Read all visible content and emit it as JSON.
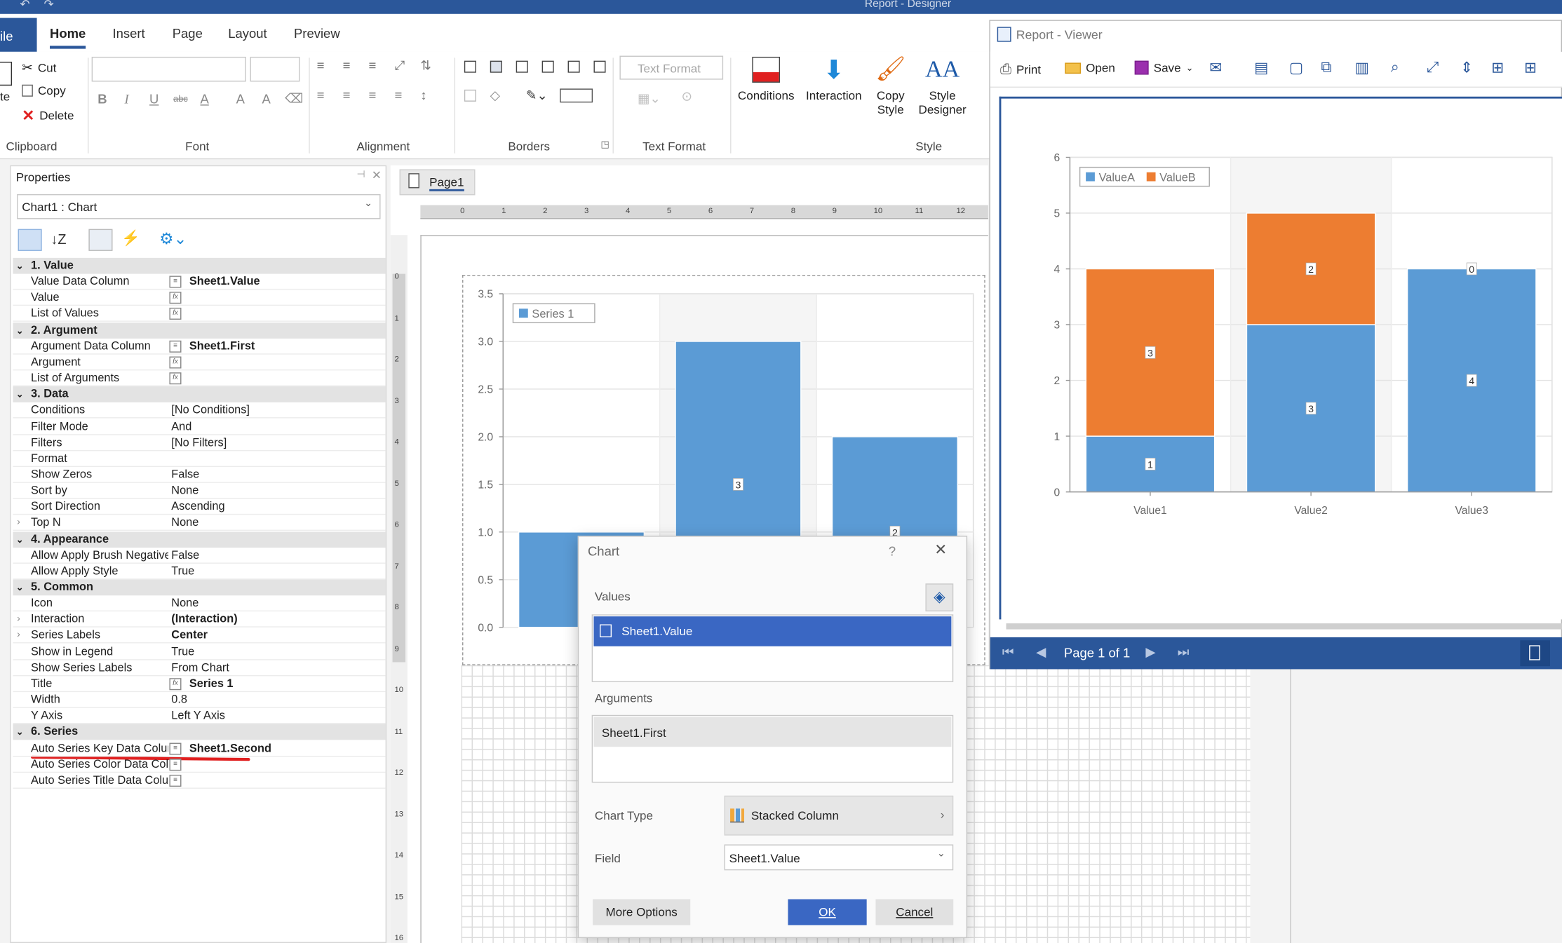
{
  "app": {
    "title": "Report - Designer"
  },
  "tabs": {
    "file": "ile",
    "home": "Home",
    "insert": "Insert",
    "page": "Page",
    "layout": "Layout",
    "preview": "Preview"
  },
  "ribbon": {
    "clipboard": {
      "paste": "te",
      "cut": "Cut",
      "copy": "Copy",
      "delete": "Delete",
      "label": "Clipboard"
    },
    "font": {
      "label": "Font",
      "bold": "B",
      "italic": "I",
      "underline": "U",
      "strike": "abc",
      "color": "A",
      "grow": "A",
      "shrink": "A"
    },
    "alignment": {
      "label": "Alignment"
    },
    "borders": {
      "label": "Borders"
    },
    "text_format": {
      "placeholder": "Text Format",
      "label": "Text Format"
    },
    "style": {
      "conditions": "Conditions",
      "interaction": "Interaction",
      "copy_style_1": "Copy",
      "copy_style_2": "Style",
      "style_designer_1": "Style",
      "style_designer_2": "Designer",
      "label": "Style"
    }
  },
  "properties": {
    "title": "Properties",
    "selector": "Chart1 : Chart",
    "rows": [
      {
        "type": "cat",
        "name": "1. Value"
      },
      {
        "name": "Value Data Column",
        "value": "Sheet1.Value",
        "bold": true,
        "icon": "column"
      },
      {
        "name": "Value",
        "value": "",
        "icon": "fx"
      },
      {
        "name": "List of Values",
        "value": "",
        "icon": "fx"
      },
      {
        "type": "cat",
        "name": "2. Argument"
      },
      {
        "name": "Argument Data Column",
        "value": "Sheet1.First",
        "bold": true,
        "icon": "column"
      },
      {
        "name": "Argument",
        "value": "",
        "icon": "fx"
      },
      {
        "name": "List of Arguments",
        "value": "",
        "icon": "fx"
      },
      {
        "type": "cat",
        "name": "3. Data"
      },
      {
        "name": "Conditions",
        "value": "[No Conditions]"
      },
      {
        "name": "Filter Mode",
        "value": "And"
      },
      {
        "name": "Filters",
        "value": "[No Filters]"
      },
      {
        "name": "Format",
        "value": ""
      },
      {
        "name": "Show Zeros",
        "value": "False"
      },
      {
        "name": "Sort by",
        "value": "None"
      },
      {
        "name": "Sort Direction",
        "value": "Ascending"
      },
      {
        "name": "Top N",
        "value": "None",
        "expand": true
      },
      {
        "type": "cat",
        "name": "4. Appearance"
      },
      {
        "name": "Allow Apply Brush Negative",
        "value": "False"
      },
      {
        "name": "Allow Apply Style",
        "value": "True"
      },
      {
        "type": "cat",
        "name": "5. Common"
      },
      {
        "name": "Icon",
        "value": "None"
      },
      {
        "name": "Interaction",
        "value": "(Interaction)",
        "bold": true,
        "expand": true
      },
      {
        "name": "Series Labels",
        "value": "Center",
        "bold": true,
        "expand": true
      },
      {
        "name": "Show in Legend",
        "value": "True"
      },
      {
        "name": "Show Series Labels",
        "value": "From Chart"
      },
      {
        "name": "Title",
        "value": "Series 1",
        "bold": true,
        "icon": "fx"
      },
      {
        "name": "Width",
        "value": "0.8"
      },
      {
        "name": "Y Axis",
        "value": "Left Y Axis"
      },
      {
        "type": "cat",
        "name": "6. Series"
      },
      {
        "name": "Auto Series Key Data Colur",
        "value": "Sheet1.Second",
        "bold": true,
        "icon": "column"
      },
      {
        "name": "Auto Series Color Data Colu",
        "value": "",
        "icon": "column"
      },
      {
        "name": "Auto Series Title Data Colun",
        "value": "",
        "icon": "column"
      }
    ]
  },
  "designer": {
    "page_tab": "Page1",
    "ruler": [
      "0",
      "1",
      "2",
      "3",
      "4",
      "5",
      "6",
      "7",
      "8",
      "9",
      "10",
      "11",
      "12"
    ],
    "vruler": [
      "0",
      "1",
      "2",
      "3",
      "4",
      "5",
      "6",
      "7",
      "8",
      "9",
      "10",
      "11",
      "12",
      "13",
      "14",
      "15",
      "16"
    ]
  },
  "viewer": {
    "title": "Report - Viewer",
    "toolbar": {
      "print": "Print",
      "open": "Open",
      "save": "Save"
    },
    "page_status": "Page 1 of 1"
  },
  "dialog": {
    "title": "Chart",
    "help": "?",
    "values_label": "Values",
    "value_item": "Sheet1.Value",
    "arguments_label": "Arguments",
    "argument_item": "Sheet1.First",
    "chart_type_label": "Chart Type",
    "chart_type": "Stacked Column",
    "field_label": "Field",
    "field": "Sheet1.Value",
    "more_options": "More Options",
    "ok": "OK",
    "cancel": "Cancel"
  },
  "chart_data": [
    {
      "type": "bar",
      "title": "",
      "xlabel": "",
      "ylabel": "",
      "ylim": [
        0,
        3.5
      ],
      "yticks": [
        "0.0",
        "0.5",
        "1.0",
        "1.5",
        "2.0",
        "2.5",
        "3.0",
        "3.5"
      ],
      "categories": [
        "",
        "",
        ""
      ],
      "series": [
        {
          "name": "Series 1",
          "values": [
            1,
            3,
            2
          ],
          "labels": [
            "",
            "3",
            "2"
          ]
        }
      ],
      "legend": "top-left",
      "grid": true,
      "color": "#5b9bd5"
    },
    {
      "type": "bar",
      "stacked": true,
      "title": "",
      "xlabel": "",
      "ylabel": "",
      "ylim": [
        0,
        6
      ],
      "yticks": [
        "0",
        "1",
        "2",
        "3",
        "4",
        "5",
        "6"
      ],
      "categories": [
        "Value1",
        "Value2",
        "Value3"
      ],
      "series": [
        {
          "name": "ValueA",
          "values": [
            1,
            3,
            4
          ],
          "labels": [
            "1",
            "3",
            "4"
          ],
          "color": "#5b9bd5"
        },
        {
          "name": "ValueB",
          "values": [
            3,
            2,
            0
          ],
          "labels": [
            "3",
            "2",
            "0"
          ],
          "color": "#ed7d31"
        }
      ],
      "legend": "top-left",
      "grid": true
    }
  ],
  "colors": {
    "accent": "#2b579a",
    "blue": "#5b9bd5",
    "orange": "#ed7d31",
    "selection": "#3a67c3",
    "annotation": "#e02020"
  }
}
